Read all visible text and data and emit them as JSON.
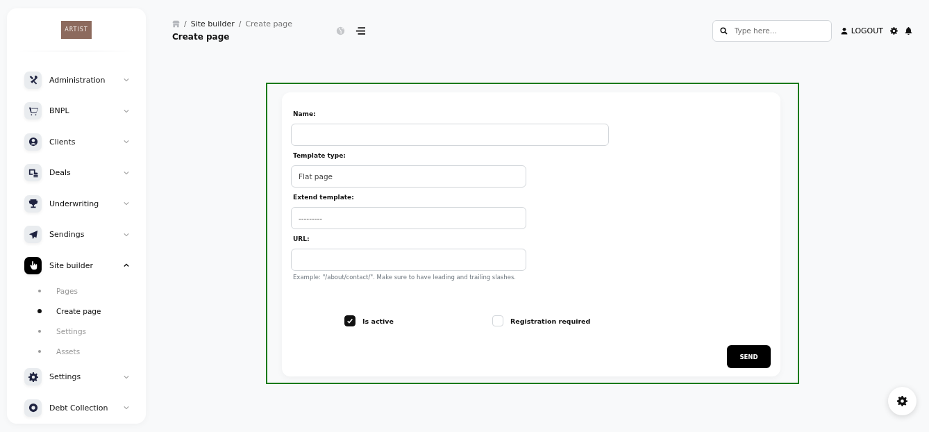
{
  "logo": {
    "text": "ARTIST"
  },
  "sidebar": {
    "items": [
      {
        "label": "Administration",
        "expanded": false,
        "selected": false
      },
      {
        "label": "BNPL",
        "expanded": false,
        "selected": false
      },
      {
        "label": "Clients",
        "expanded": false,
        "selected": false
      },
      {
        "label": "Deals",
        "expanded": false,
        "selected": false
      },
      {
        "label": "Underwriting",
        "expanded": false,
        "selected": false
      },
      {
        "label": "Sendings",
        "expanded": false,
        "selected": false
      },
      {
        "label": "Site builder",
        "expanded": true,
        "selected": true,
        "children": [
          {
            "label": "Pages",
            "selected": false
          },
          {
            "label": "Create page",
            "selected": true
          },
          {
            "label": "Settings",
            "selected": false
          },
          {
            "label": "Assets",
            "selected": false
          }
        ]
      },
      {
        "label": "Settings",
        "expanded": false,
        "selected": false
      },
      {
        "label": "Debt Collection",
        "expanded": false,
        "selected": false
      }
    ]
  },
  "breadcrumb": [
    {
      "separator": "/",
      "label": "Site builder"
    },
    {
      "separator": "/",
      "label": "Create page"
    }
  ],
  "page_title": "Create page",
  "search": {
    "placeholder": "Type here..."
  },
  "logout": "LOGOUT",
  "form": {
    "fields": [
      {
        "label": "Name:"
      },
      {
        "label": "Template type:",
        "value": "Flat page"
      },
      {
        "label": "Extend template:",
        "value": "---------"
      },
      {
        "label": "URL:",
        "hint": "Example: \"/about/contact/\". Make sure to have leading and trailing slashes."
      }
    ],
    "checkboxes": [
      {
        "label": "Is active",
        "checked": true
      },
      {
        "label": "Registration required",
        "checked": false
      }
    ],
    "submit": "SEND"
  }
}
